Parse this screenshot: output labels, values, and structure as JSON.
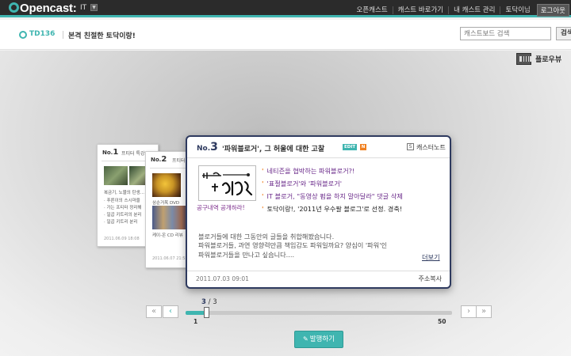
{
  "header": {
    "logo": "Opencast:",
    "category": "IT",
    "nav": [
      "오픈캐스트",
      "캐스트 바로가기",
      "내 캐스트 관리",
      "토닥이님"
    ],
    "login": "로그아웃"
  },
  "subheader": {
    "code": "TD136",
    "title": "본격 친절한 토닥이랑!",
    "search_placeholder": "캐스트보드 검색",
    "search_button": "검색"
  },
  "view": {
    "flow_label": "플로우뷰"
  },
  "back_cards": [
    {
      "no_prefix": "No.",
      "no": "1",
      "title": "프티터 특강",
      "lines": [
        "복금기, 노블의 탄생...",
        "· 푸른이의 스시마을",
        "· 가는 프티터 정리해",
        "· 일곱 키트리의 분리",
        "· 일곱 키트리 분리"
      ],
      "date": "2011.06.09 18:08"
    },
    {
      "no_prefix": "No.",
      "no": "2",
      "title": "프티터",
      "lines": [
        "삼순거목 DVD",
        "케이-온 CD 리뷰"
      ],
      "date": "2011.06.07 21:58"
    }
  ],
  "card": {
    "no_prefix": "No.",
    "no": "3",
    "title": "'파워블로거', 그 허울에 대한 고찰",
    "edit_badge": "EDIT",
    "new_badge": "N",
    "cast_icon": "S",
    "cast_note": "캐스터노트",
    "thumb_caption": "공구내역 공개하라!",
    "bullets": [
      "네티즌을 협박하는 파워블로거?!",
      "'표절블로거'와 '파워블로거'",
      "IT 블로거, \"동영상 펌을 하지 말아달라\" 댓글 삭제",
      "토닥이랑!, '2011년 우수팔 블로그'로 선정. 경축!"
    ],
    "description_lines": [
      "블로거들에 대한 그동안의 글들을 취합해봤습니다.",
      "파워블로거들, 과연 영향력만큼 책임감도 파워일까요? 양심이 '파워'인",
      "파워블로거들을 만나고 싶습니다...."
    ],
    "more": "더보기",
    "date": "2011.07.03 09:01",
    "copy_address": "주소복사"
  },
  "pager": {
    "first": "«",
    "prev": "‹",
    "next": "›",
    "last": "»",
    "current": "3",
    "total": "3",
    "min": "1",
    "max": "50",
    "progress": 0.04
  },
  "publish_button": "발행하기",
  "colors": {
    "accent": "#3fb5b0",
    "navy": "#2e3a5f",
    "bullet_text": "#6a2a8a",
    "orange": "#f08020"
  }
}
